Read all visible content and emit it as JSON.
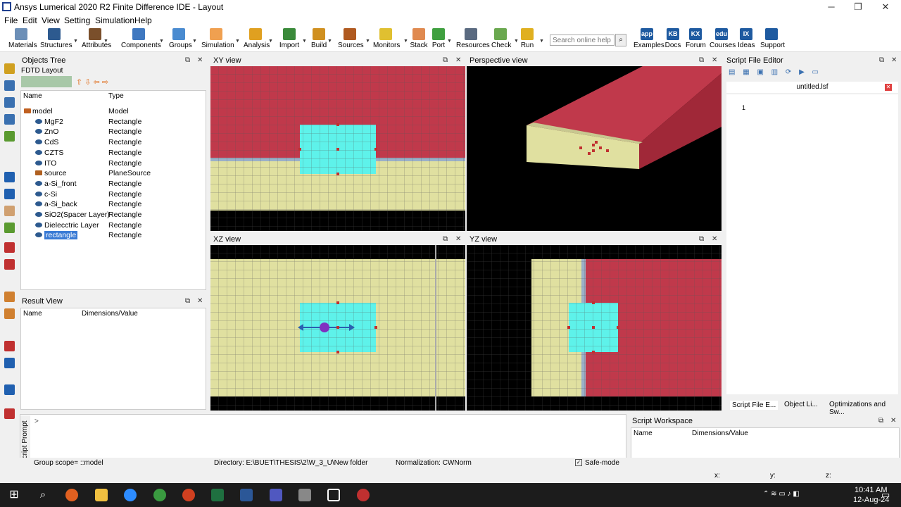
{
  "window": {
    "title": "Ansys Lumerical 2020 R2 Finite Difference IDE - Layout",
    "minimize": "─",
    "maximize": "❐",
    "close": "✕"
  },
  "menu": [
    "File",
    "Edit",
    "View",
    "Setting",
    "Simulation",
    "Help"
  ],
  "toolbar": {
    "items": [
      {
        "label": "Materials",
        "color": "#6c8fb7"
      },
      {
        "label": "Structures",
        "color": "#2d5a8f"
      },
      {
        "label": "Attributes",
        "color": "#7a4f2b"
      },
      {
        "label": "Components",
        "color": "#3f78c0"
      },
      {
        "label": "Groups",
        "color": "#4a8bd0"
      },
      {
        "label": "Simulation",
        "color": "#f0a050"
      },
      {
        "label": "Analysis",
        "color": "#e0a020"
      },
      {
        "label": "Import",
        "color": "#3a8a3a"
      },
      {
        "label": "Build",
        "color": "#d09020"
      },
      {
        "label": "Sources",
        "color": "#b05a20"
      },
      {
        "label": "Monitors",
        "color": "#e0c030"
      },
      {
        "label": "Stack",
        "color": "#e08a50"
      },
      {
        "label": "Port",
        "color": "#40a040"
      },
      {
        "label": "Resources",
        "color": "#5a6a80"
      },
      {
        "label": "Check",
        "color": "#6aa84f"
      },
      {
        "label": "Run",
        "color": "#e0b020"
      },
      {
        "label": "Examples",
        "color": "#1e5aa0"
      },
      {
        "label": "Docs",
        "color": "#1e5aa0"
      },
      {
        "label": "Forum",
        "color": "#1e5aa0"
      },
      {
        "label": "Courses",
        "color": "#1e5aa0"
      },
      {
        "label": "Ideas",
        "color": "#1e5aa0"
      },
      {
        "label": "Support",
        "color": "#1e5aa0"
      }
    ],
    "badges": {
      "Examples": "app",
      "Docs": "KB",
      "Forum": "KX",
      "Courses": "edu",
      "Ideas": "IX"
    },
    "search_placeholder": "Search online help"
  },
  "objects_tree": {
    "title": "Objects Tree",
    "subtitle": "FDTD Layout",
    "col_name": "Name",
    "col_type": "Type",
    "rows": [
      {
        "name": "model",
        "type": "Model"
      },
      {
        "name": "MgF2",
        "type": "Rectangle"
      },
      {
        "name": "ZnO",
        "type": "Rectangle"
      },
      {
        "name": "CdS",
        "type": "Rectangle"
      },
      {
        "name": "CZTS",
        "type": "Rectangle"
      },
      {
        "name": "ITO",
        "type": "Rectangle"
      },
      {
        "name": "source",
        "type": "PlaneSource"
      },
      {
        "name": "a-Si_front",
        "type": "Rectangle"
      },
      {
        "name": "c-Si",
        "type": "Rectangle"
      },
      {
        "name": "a-Si_back",
        "type": "Rectangle"
      },
      {
        "name": "SiO2(Spacer Layer)",
        "type": "Rectangle"
      },
      {
        "name": "Dielecctric Layer",
        "type": "Rectangle"
      },
      {
        "name": "rectangle",
        "type": "Rectangle",
        "selected": true
      }
    ]
  },
  "result_view": {
    "title": "Result View",
    "col_name": "Name",
    "col_value": "Dimensions/Value"
  },
  "views": {
    "xy": "XY view",
    "perspective": "Perspective view",
    "xz": "XZ view",
    "yz": "YZ view"
  },
  "script_editor": {
    "title": "Script File Editor",
    "file": "untitled.lsf",
    "line": "1"
  },
  "bottom_tabs": [
    "Script File E...",
    "Object Li...",
    "Optimizations and Sw..."
  ],
  "script_prompt": {
    "label": "Script Prompt",
    "prompt": ">"
  },
  "workspace": {
    "title": "Script Workspace",
    "col_name": "Name",
    "col_value": "Dimensions/Value"
  },
  "status": {
    "scope": "Group scope= ::model",
    "directory": "Directory: E:\\BUET\\THESIS\\2\\W_3_U\\New folder",
    "normalization": "Normalization: CWNorm",
    "safe_mode": "Safe-mode",
    "x": "x:",
    "y": "y:",
    "z": "z:"
  },
  "colors": {
    "red": "#c0394b",
    "yellow": "#e0e0a0",
    "cyan": "#5ef2ea",
    "black": "#000000"
  },
  "taskbar": {
    "time": "10:41 AM",
    "date": "12-Aug-24"
  }
}
